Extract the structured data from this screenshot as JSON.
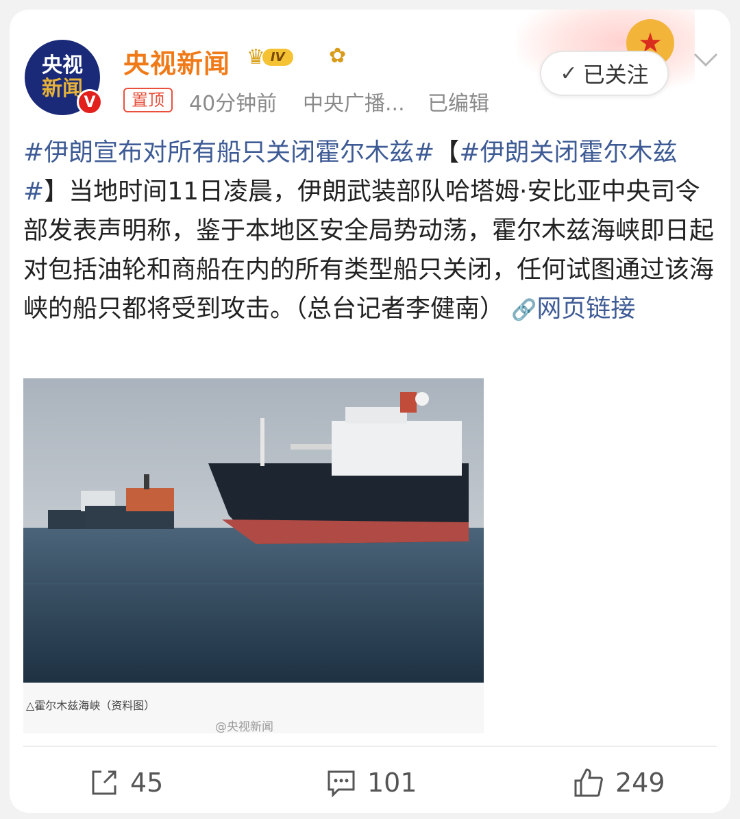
{
  "account": {
    "avatar_line1": "央视",
    "avatar_line2": "新闻",
    "verified_mark": "V",
    "name": "央视新闻",
    "level": "IV",
    "crown_icon": "crown-icon",
    "flower_icon": "sunflower-icon"
  },
  "meta": {
    "pinned": "置顶",
    "time": "40分钟前",
    "source": "中央广播...",
    "edited": "已编辑"
  },
  "follow": {
    "check": "✓",
    "label": "已关注"
  },
  "post": {
    "tag1": "#伊朗宣布对所有船只关闭霍尔木兹#",
    "bracket_open": "【",
    "tag2": "#伊朗关闭霍尔木兹#",
    "bracket_close": "】",
    "body": "当地时间11日凌晨，伊朗武装部队哈塔姆·安比亚中央司令部发表声明称，鉴于本地区安全局势动荡，霍尔木兹海峡即日起对包括油轮和商船在内的所有类型船只关闭，任何试图通过该海峡的船只都将受到攻击。（总台记者李健南）",
    "link_label": "网页链接"
  },
  "image": {
    "caption": "△霍尔木兹海峡（资料图）",
    "watermark": "@央视新闻"
  },
  "actions": {
    "share_count": "45",
    "comment_count": "101",
    "like_count": "249"
  },
  "colors": {
    "accent_orange": "#f07a18",
    "link_blue": "#3e5b95",
    "pin_red": "#e8503c"
  }
}
